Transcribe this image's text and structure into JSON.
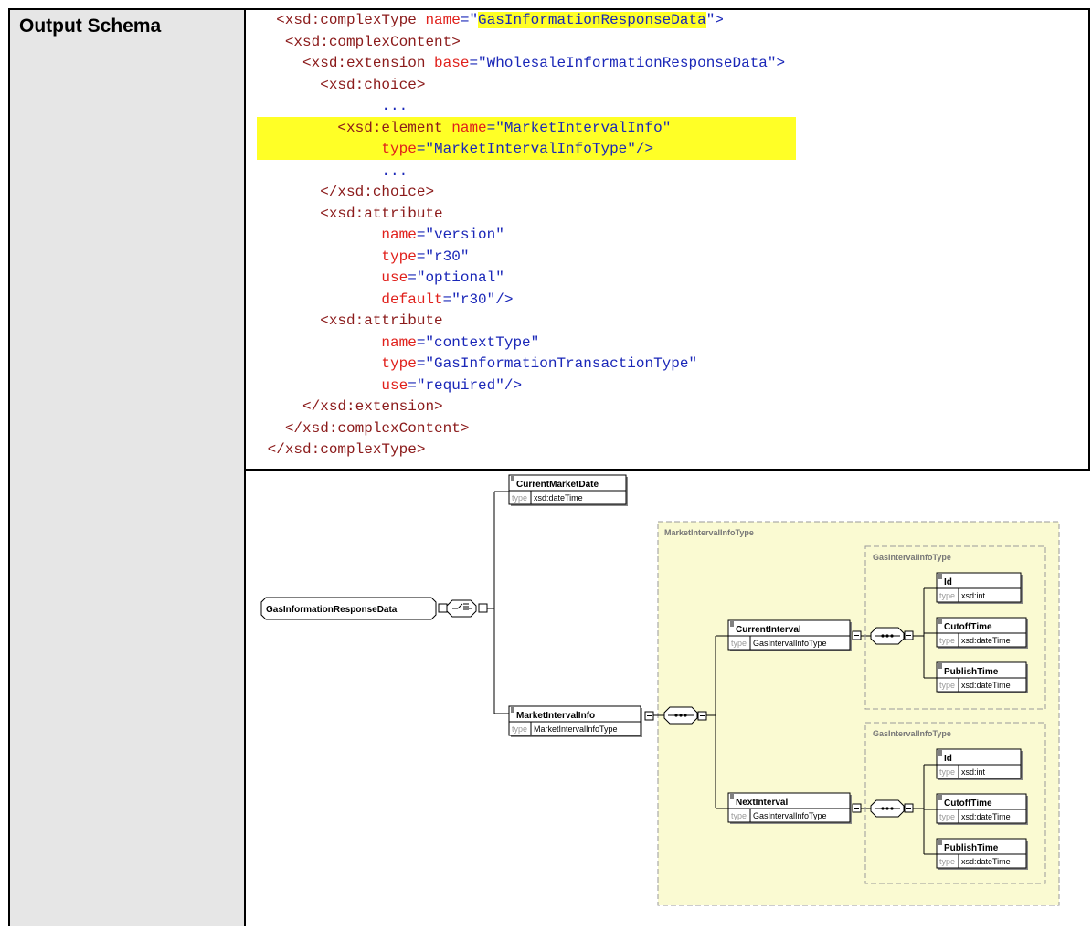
{
  "row_label": "Output Schema",
  "code_lines": [
    {
      "indent": "  ",
      "segments": [
        {
          "t": "<xsd:complexType ",
          "c": "tag"
        },
        {
          "t": "name",
          "c": "attr"
        },
        {
          "t": "=\"",
          "c": "val"
        },
        {
          "t": "GasInformationResponseData",
          "c": "val",
          "hl": true
        },
        {
          "t": "\">",
          "c": "val"
        }
      ]
    },
    {
      "indent": "   ",
      "segments": [
        {
          "t": "<xsd:complexContent>",
          "c": "tag"
        }
      ]
    },
    {
      "indent": "     ",
      "segments": [
        {
          "t": "<xsd:extension ",
          "c": "tag"
        },
        {
          "t": "base",
          "c": "attr"
        },
        {
          "t": "=\"WholesaleInformationResponseData\">",
          "c": "val"
        }
      ]
    },
    {
      "indent": "       ",
      "segments": [
        {
          "t": "<xsd:choice>",
          "c": "tag"
        }
      ]
    },
    {
      "indent": "              ",
      "segments": [
        {
          "t": "...",
          "c": "val"
        }
      ]
    },
    {
      "indent": "         ",
      "segments": [
        {
          "t": "<xsd:element ",
          "c": "tag"
        },
        {
          "t": "name",
          "c": "attr"
        },
        {
          "t": "=\"MarketIntervalInfo\"",
          "c": "val"
        }
      ]
    },
    {
      "indent": "              ",
      "segments": [
        {
          "t": "type",
          "c": "attr"
        },
        {
          "t": "=\"MarketIntervalInfoType\"/>",
          "c": "val"
        }
      ]
    },
    {
      "indent": "              ",
      "segments": [
        {
          "t": "...",
          "c": "val"
        }
      ]
    },
    {
      "indent": "       ",
      "segments": [
        {
          "t": "</xsd:choice>",
          "c": "tag"
        }
      ]
    },
    {
      "indent": "       ",
      "segments": [
        {
          "t": "<xsd:attribute",
          "c": "tag"
        }
      ]
    },
    {
      "indent": "              ",
      "segments": [
        {
          "t": "name",
          "c": "attr"
        },
        {
          "t": "=\"version\"",
          "c": "val"
        }
      ]
    },
    {
      "indent": "              ",
      "segments": [
        {
          "t": "type",
          "c": "attr"
        },
        {
          "t": "=\"r30\"",
          "c": "val"
        }
      ]
    },
    {
      "indent": "              ",
      "segments": [
        {
          "t": "use",
          "c": "attr"
        },
        {
          "t": "=\"optional\"",
          "c": "val"
        }
      ]
    },
    {
      "indent": "              ",
      "segments": [
        {
          "t": "default",
          "c": "attr"
        },
        {
          "t": "=\"r30\"/>",
          "c": "val"
        }
      ]
    },
    {
      "indent": "       ",
      "segments": [
        {
          "t": "<xsd:attribute",
          "c": "tag"
        }
      ]
    },
    {
      "indent": "              ",
      "segments": [
        {
          "t": "name",
          "c": "attr"
        },
        {
          "t": "=\"contextType\"",
          "c": "val"
        }
      ]
    },
    {
      "indent": "              ",
      "segments": [
        {
          "t": "type",
          "c": "attr"
        },
        {
          "t": "=\"GasInformationTransactionType\"",
          "c": "val"
        }
      ]
    },
    {
      "indent": "              ",
      "segments": [
        {
          "t": "use",
          "c": "attr"
        },
        {
          "t": "=\"required\"/>",
          "c": "val"
        }
      ]
    },
    {
      "indent": "     ",
      "segments": [
        {
          "t": "</xsd:extension>",
          "c": "tag"
        }
      ]
    },
    {
      "indent": "   ",
      "segments": [
        {
          "t": "</xsd:complexContent>",
          "c": "tag"
        }
      ]
    },
    {
      "indent": " ",
      "segments": [
        {
          "t": "</xsd:complexType>",
          "c": "tag"
        }
      ]
    }
  ],
  "colors": {
    "tag": "#8b1a1a",
    "attr": "#e0201b",
    "val": "#1a27b8",
    "highlight": "#ffff26",
    "group_bg": "#fafad2"
  },
  "diagram": {
    "root": "GasInformationResponseData",
    "type_label": "type",
    "current_market_date": {
      "name": "CurrentMarketDate",
      "type": "xsd:dateTime"
    },
    "market_interval_info": {
      "name": "MarketIntervalInfo",
      "type": "MarketIntervalInfoType"
    },
    "market_group_title": "MarketIntervalInfoType",
    "intervals": [
      {
        "name": "CurrentInterval",
        "type": "GasIntervalInfoType",
        "group_title": "GasIntervalInfoType",
        "children": [
          {
            "name": "Id",
            "type": "xsd:int"
          },
          {
            "name": "CutoffTime",
            "type": "xsd:dateTime"
          },
          {
            "name": "PublishTime",
            "type": "xsd:dateTime"
          }
        ]
      },
      {
        "name": "NextInterval",
        "type": "GasIntervalInfoType",
        "group_title": "GasIntervalInfoType",
        "children": [
          {
            "name": "Id",
            "type": "xsd:int"
          },
          {
            "name": "CutoffTime",
            "type": "xsd:dateTime"
          },
          {
            "name": "PublishTime",
            "type": "xsd:dateTime"
          }
        ]
      }
    ]
  }
}
